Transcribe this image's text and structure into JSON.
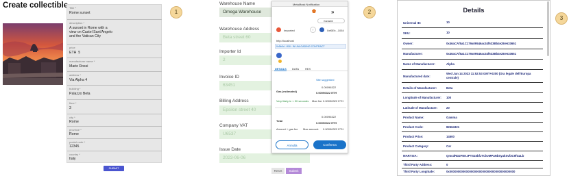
{
  "panel1": {
    "title": "Create collectible",
    "fields": [
      {
        "label": "Title *",
        "value": "Rome sunset"
      },
      {
        "label": "description *",
        "value": "A sunset in Rome with a\nview on Castel Sant'Angelo\nand the Vatican City"
      },
      {
        "label": "price",
        "value": "ETH  5"
      },
      {
        "label": "manufacturer name *",
        "value": "Mario Rossi"
      },
      {
        "label": "address *",
        "value": "Via Alpha 4"
      },
      {
        "label": "building *",
        "value": "Palazzo Beta"
      },
      {
        "label": "floor *",
        "value": "3"
      },
      {
        "label": "city *",
        "value": "Rome"
      },
      {
        "label": "province *",
        "value": "Rome"
      },
      {
        "label": "postal code *",
        "value": "12345"
      },
      {
        "label": "country *",
        "value": "Italy"
      }
    ],
    "submit_label": "SUBMIT"
  },
  "badges": [
    "1",
    "2",
    "3"
  ],
  "panel2": {
    "fields": [
      {
        "label": "Warehouse Name",
        "value": "Omega Warehouse",
        "style": "dark"
      },
      {
        "label": "Warehouse Address",
        "value": "Beta street 60",
        "style": "green"
      },
      {
        "label": "Importer Id",
        "value": "2",
        "style": "green"
      },
      {
        "label": "Invoice ID",
        "value": "63451",
        "style": "green"
      },
      {
        "label": "Billing Address",
        "value": "Epsilon street 40",
        "style": "green"
      },
      {
        "label": "Company VAT",
        "value": "U6537",
        "style": "green"
      },
      {
        "label": "Issue Date",
        "value": "2023-06-06",
        "style": "green"
      }
    ],
    "reset_label": "Reset",
    "submit_label": "Submit"
  },
  "metamask": {
    "title": "MetaMask Notification",
    "network": "Ganache",
    "account_from": "Imported",
    "account_to": "0xf6Eb...1054",
    "origin": "http://localhost",
    "address_short": "0x5b0d...ff18  :  IN UNLOADING CONTRACT",
    "tabs": [
      "DETAILS",
      "DATA",
      "HEX"
    ],
    "edit_label": "Site suggested",
    "gas_label": "Gas (estimated)",
    "gas_amount": "0.00096322",
    "gas_eth": "0.00096322 ETH",
    "likely_label": "Very likely in < 30 seconds",
    "max_fee_label": "Max fee:",
    "max_fee_value": "0.00096322 ETH",
    "total_label": "Total",
    "total_amount": "0.00096322",
    "total_eth": "0.00096322 ETH",
    "amount_gas_label": "Amount + gas fee",
    "max_amount_label": "Max amount:",
    "max_amount_value": "0.00096322 ETH",
    "reject_label": "Annulla",
    "confirm_label": "Conferma"
  },
  "panel3": {
    "title": "Details",
    "rows": [
      {
        "key": "Universal ID:",
        "value": "10"
      },
      {
        "key": "SKU:",
        "value": "10"
      },
      {
        "key": "Owner:",
        "value": "0x46aCAf5a1C179a09546ac34f633Bb4e2Ee633651"
      },
      {
        "key": "Manufacturer:",
        "value": "0x46aCAf5a1C179a09546ac34f633Bb4e2Ee633651"
      },
      {
        "key": "Name of Manufacturer:",
        "value": "Alpha"
      },
      {
        "key": "Manufactured date:",
        "value": "Wed Jun 14 2023 11:52:53 GMT+0200 (Ora legale dell'Europa\ncentrale)"
      },
      {
        "key": "Details of Manufacturer:",
        "value": "Beta"
      },
      {
        "key": "Longitude of Manufacturer:",
        "value": "100"
      },
      {
        "key": "Latitude of Manufacture:",
        "value": "20"
      },
      {
        "key": "Product Name:",
        "value": "Gamma"
      },
      {
        "key": "Product Code:",
        "value": "82664321"
      },
      {
        "key": "Product Price:",
        "value": "14500"
      },
      {
        "key": "Product Category:",
        "value": "Car"
      },
      {
        "key": "MARTSIA:",
        "value": "QmcdRD2FEKJPTS15bfJTCkvMPaNbSyakSvf3C9fGaLb"
      },
      {
        "key": "Third Party Address:",
        "value": "0"
      },
      {
        "key": "Third Party Longitude:",
        "value": "0x0000000000000000000000000000000000000000"
      }
    ]
  }
}
